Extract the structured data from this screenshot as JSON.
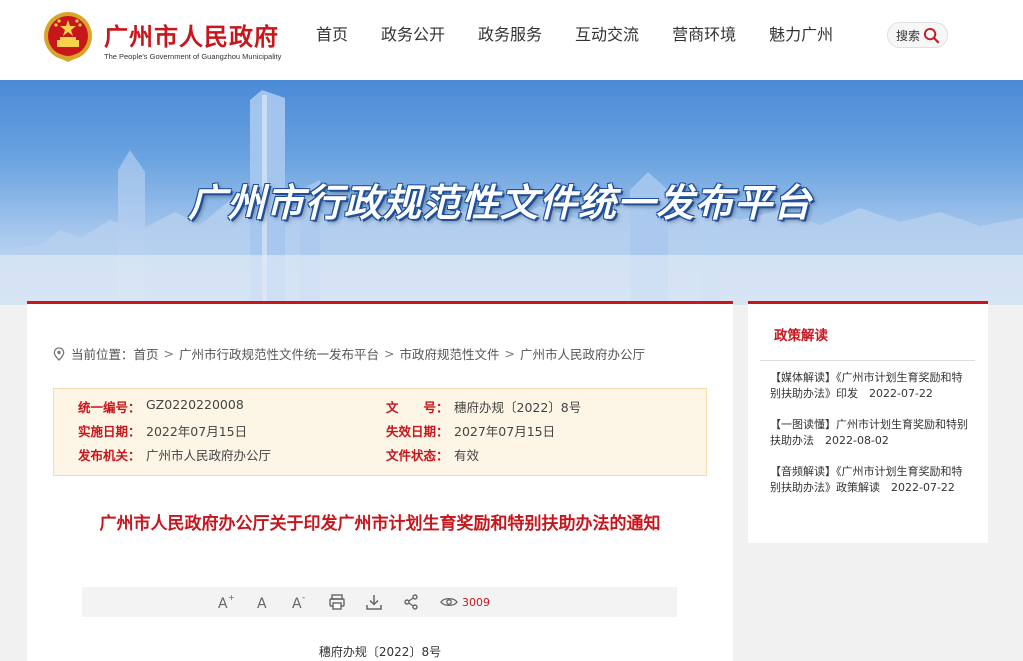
{
  "header": {
    "site_name": "广州市人民政府",
    "site_name_en": "The People's Government of Guangzhou Municipality",
    "nav": [
      "首页",
      "政务公开",
      "政务服务",
      "互动交流",
      "营商环境",
      "魅力广州"
    ],
    "search_label": "搜索"
  },
  "banner": {
    "title": "广州市行政规范性文件统一发布平台"
  },
  "breadcrumb": {
    "prefix": "当前位置：",
    "items": [
      "首页",
      "广州市行政规范性文件统一发布平台",
      "市政府规范性文件",
      "广州市人民政府办公厅"
    ],
    "separator": ">"
  },
  "meta": {
    "serial_label": "统一编号：",
    "serial_value": "GZ0220220008",
    "docnum_label": "文　　号：",
    "docnum_value": "穗府办规〔2022〕8号",
    "effective_label": "实施日期：",
    "effective_value": "2022年07月15日",
    "expire_label": "失效日期：",
    "expire_value": "2027年07月15日",
    "issuer_label": "发布机关：",
    "issuer_value": "广州市人民政府办公厅",
    "status_label": "文件状态：",
    "status_value": "有效"
  },
  "document": {
    "title": "广州市人民政府办公厅关于印发广州市计划生育奖励和特别扶助办法的通知",
    "doc_number": "穗府办规〔2022〕8号",
    "views": "3009"
  },
  "sidebar": {
    "title": "政策解读",
    "items": [
      "【媒体解读】《广州市计划生育奖励和特别扶助办法》印发　2022-07-22",
      "【一图读懂】广州市计划生育奖励和特别扶助办法　2022-08-02",
      "【音频解读】《广州市计划生育奖励和特别扶助办法》政策解读　2022-07-22"
    ]
  },
  "colors": {
    "brand_red": "#c8161d",
    "meta_bg": "#fdf6e6"
  }
}
